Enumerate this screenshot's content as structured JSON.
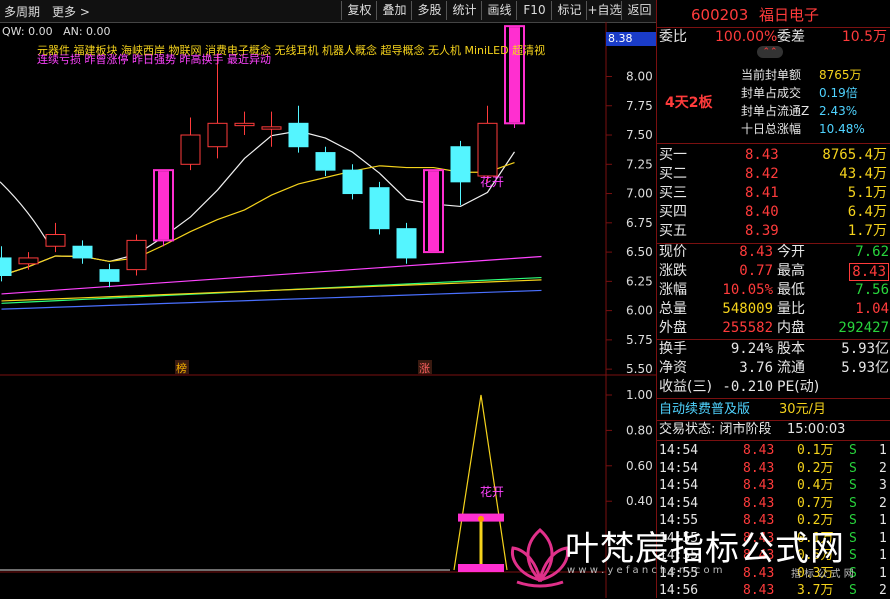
{
  "toolbar": {
    "period": "多周期",
    "more": "更多",
    "buttons": [
      "复权",
      "叠加",
      "多股",
      "统计",
      "画线",
      "F10",
      "标记",
      "+自选",
      "返回"
    ]
  },
  "indicator_line": {
    "qw": "QW: 0.00",
    "an": "AN: 0.00",
    "concepts": "元器件  福建板块  海峡西岸 物联网 消费电子概念 无线耳机 机器人概念 超导概念 无人机 MiniLED 超清视",
    "signals": "连续亏损 昨曾涨停 昨日强势 昨高换手 最近异动"
  },
  "price_badge": "8.38",
  "price_axis": [
    "8.00",
    "7.75",
    "7.50",
    "7.25",
    "7.00",
    "6.75",
    "6.50",
    "6.25",
    "6.00",
    "5.75",
    "5.50"
  ],
  "lower_axis": [
    "1.00",
    "0.80",
    "0.60",
    "0.40"
  ],
  "marks": {
    "bang": "榜",
    "zhang": "涨",
    "huakai_top": "花开",
    "huakai_bottom": "花开"
  },
  "chart_data": {
    "type": "candlestick",
    "y_range": [
      5.45,
      8.38
    ],
    "candles": [
      {
        "o": 6.45,
        "c": 6.3,
        "h": 6.55,
        "l": 6.25
      },
      {
        "o": 6.4,
        "c": 6.45,
        "h": 6.5,
        "l": 6.35
      },
      {
        "o": 6.55,
        "c": 6.65,
        "h": 6.75,
        "l": 6.5
      },
      {
        "o": 6.55,
        "c": 6.45,
        "h": 6.6,
        "l": 6.4
      },
      {
        "o": 6.35,
        "c": 6.25,
        "h": 6.4,
        "l": 6.2
      },
      {
        "o": 6.35,
        "c": 6.6,
        "h": 6.65,
        "l": 6.3
      },
      {
        "o": 6.6,
        "c": 7.2,
        "h": 7.2,
        "l": 6.55
      },
      {
        "o": 7.25,
        "c": 7.5,
        "h": 7.65,
        "l": 7.2
      },
      {
        "o": 7.4,
        "c": 7.6,
        "h": 8.2,
        "l": 7.3
      },
      {
        "o": 7.58,
        "c": 7.6,
        "h": 7.7,
        "l": 7.5
      },
      {
        "o": 7.55,
        "c": 7.57,
        "h": 7.7,
        "l": 7.4
      },
      {
        "o": 7.6,
        "c": 7.4,
        "h": 7.75,
        "l": 7.35
      },
      {
        "o": 7.35,
        "c": 7.2,
        "h": 7.4,
        "l": 7.15
      },
      {
        "o": 7.2,
        "c": 7.0,
        "h": 7.25,
        "l": 6.95
      },
      {
        "o": 7.05,
        "c": 6.7,
        "h": 7.1,
        "l": 6.65
      },
      {
        "o": 6.7,
        "c": 6.45,
        "h": 6.75,
        "l": 6.4
      },
      {
        "o": 6.5,
        "c": 7.2,
        "h": 7.2,
        "l": 6.5
      },
      {
        "o": 7.4,
        "c": 7.1,
        "h": 7.45,
        "l": 6.9
      },
      {
        "o": 7.15,
        "c": 7.6,
        "h": 7.75,
        "l": 7.1
      },
      {
        "o": 7.6,
        "c": 8.43,
        "h": 8.43,
        "l": 7.56
      }
    ]
  },
  "quote": {
    "code": "600203",
    "name": "福日电子",
    "weibi_label": "委比",
    "weibi": "100.00%",
    "weicha_label": "委差",
    "weicha": "10.5万",
    "board_days": "4天2板",
    "seal": [
      {
        "label": "当前封单额",
        "value": "8765万"
      },
      {
        "label": "封单占成交",
        "value": "0.19倍"
      },
      {
        "label": "封单占流通Z",
        "value": "2.43%"
      },
      {
        "label": "十日总涨幅",
        "value": "10.48%"
      }
    ],
    "buy": [
      {
        "label": "买一",
        "price": "8.43",
        "vol": "8765.4万"
      },
      {
        "label": "买二",
        "price": "8.42",
        "vol": "43.4万"
      },
      {
        "label": "买三",
        "price": "8.41",
        "vol": "5.1万"
      },
      {
        "label": "买四",
        "price": "8.40",
        "vol": "6.4万"
      },
      {
        "label": "买五",
        "price": "8.39",
        "vol": "1.7万"
      }
    ],
    "stats": [
      {
        "l1": "现价",
        "v1": "8.43",
        "l2": "今开",
        "v2": "7.62",
        "c1": "red",
        "c2": "green"
      },
      {
        "l1": "涨跌",
        "v1": "0.77",
        "l2": "最高",
        "v2": "8.43",
        "c1": "red",
        "c2": "red"
      },
      {
        "l1": "涨幅",
        "v1": "10.05%",
        "l2": "最低",
        "v2": "7.56",
        "c1": "red",
        "c2": "green"
      },
      {
        "l1": "总量",
        "v1": "548009",
        "l2": "量比",
        "v2": "1.04",
        "c1": "yellow",
        "c2": "red"
      },
      {
        "l1": "外盘",
        "v1": "255582",
        "l2": "内盘",
        "v2": "292427",
        "c1": "red",
        "c2": "green"
      }
    ],
    "stats2": [
      {
        "l1": "换手",
        "v1": "9.24%",
        "l2": "股本",
        "v2": "5.93亿"
      },
      {
        "l1": "净资",
        "v1": "3.76",
        "l2": "流通",
        "v2": "5.93亿"
      },
      {
        "l1": "收益(三)",
        "v1": "-0.210",
        "l2": "PE(动)",
        "v2": ""
      }
    ],
    "promo": "自动续费普及版",
    "promo_price": "30元/月",
    "status_label": "交易状态: 闭市阶段",
    "status_time": "15:00:03",
    "ticks": [
      {
        "t": "14:54",
        "p": "8.43",
        "v": "0.1万",
        "s": "S",
        "n": "1"
      },
      {
        "t": "14:54",
        "p": "8.43",
        "v": "0.2万",
        "s": "S",
        "n": "2"
      },
      {
        "t": "14:54",
        "p": "8.43",
        "v": "0.4万",
        "s": "S",
        "n": "3"
      },
      {
        "t": "14:54",
        "p": "8.43",
        "v": "0.7万",
        "s": "S",
        "n": "2"
      },
      {
        "t": "14:55",
        "p": "8.43",
        "v": "0.2万",
        "s": "S",
        "n": "1"
      },
      {
        "t": "14:55",
        "p": "8.43",
        "v": "0.1万",
        "s": "S",
        "n": "1"
      },
      {
        "t": "14:55",
        "p": "8.43",
        "v": "0.5万",
        "s": "S",
        "n": "1"
      },
      {
        "t": "14:55",
        "p": "8.43",
        "v": "0.3万",
        "s": "S",
        "n": "1"
      },
      {
        "t": "14:56",
        "p": "8.43",
        "v": "3.7万",
        "s": "S",
        "n": "2"
      }
    ]
  },
  "watermark": {
    "title": "叶梵宸指标公式网",
    "url": "w w w . y e f a n c h e n . c o m",
    "tag": "指 标 公 式 网"
  }
}
